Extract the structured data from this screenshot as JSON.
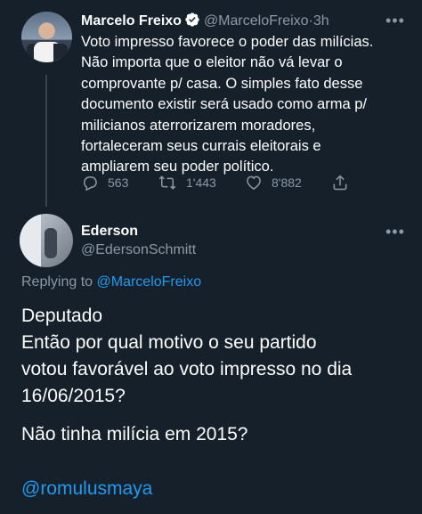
{
  "tweet": {
    "author": "Marcelo Freixo",
    "handle": "@MarceloFreixo",
    "separator": "·",
    "time": "3h",
    "more_label": "•••",
    "lines": [
      "Voto impresso favorece o poder das milícias.",
      "Não importa que o eleitor não vá levar o",
      "comprovante p/ casa. O simples fato desse",
      "documento existir será usado como arma p/",
      "milicianos aterrorizarem moradores,",
      "fortaleceram seus currais eleitorais e",
      "ampliarem seu poder político."
    ],
    "stats": {
      "replies": "563",
      "retweets": "1'443",
      "likes": "8'882"
    }
  },
  "reply": {
    "author": "Ederson",
    "handle": "@EdersonSchmitt",
    "more_label": "•••",
    "replying_prefix": "Replying to",
    "replying_to": "@MarceloFreixo",
    "lines": [
      "Deputado",
      "Então por qual motivo o seu partido",
      "votou favorável ao voto impresso no dia",
      "16/06/2015?"
    ],
    "line2": "Não tinha milícia em 2015?",
    "mention": "@romulusmaya"
  },
  "colors": {
    "background": "#15202b",
    "secondary_text": "#8b98a5",
    "link": "#1d9bf0"
  }
}
